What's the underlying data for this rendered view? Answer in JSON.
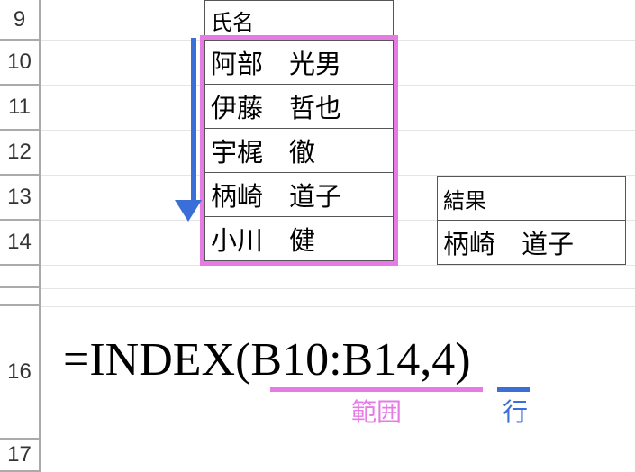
{
  "rows": {
    "r9": "9",
    "r10": "10",
    "r11": "11",
    "r12": "12",
    "r13": "13",
    "r14": "14",
    "r16": "16",
    "r17": "17"
  },
  "table": {
    "header": "氏名",
    "names": [
      "阿部　光男",
      "伊藤　哲也",
      "宇梶　徹",
      "柄崎　道子",
      "小川　健"
    ]
  },
  "result": {
    "label": "結果",
    "value": "柄崎　道子"
  },
  "formula": {
    "text": "=INDEX(B10:B14,4)",
    "range_label": "範囲",
    "row_label": "行"
  }
}
